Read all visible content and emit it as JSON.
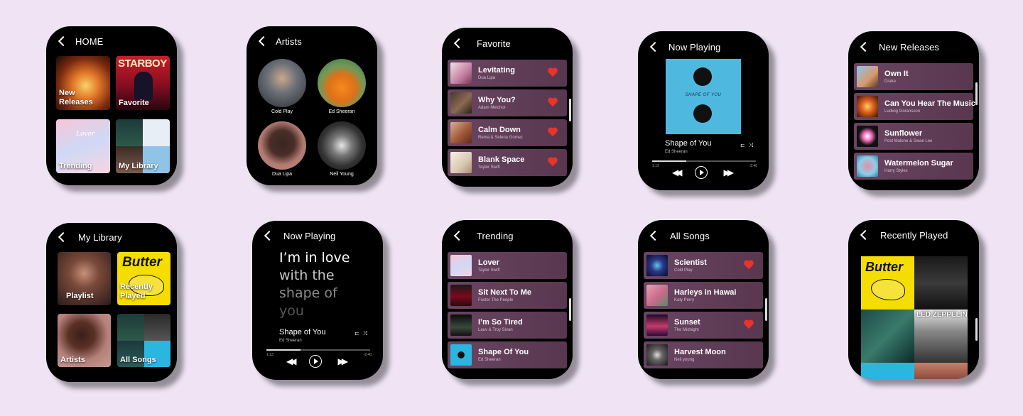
{
  "screens": {
    "home": {
      "title": "HOME",
      "tiles": [
        "New Releases",
        "Favorite",
        "Trending",
        "My Library"
      ],
      "tile1_line1": "New",
      "tile1_line2": "Releases"
    },
    "artists": {
      "title": "Artists",
      "items": [
        "Cold Play",
        "Ed Sheeran",
        "Dua Lipa",
        "Neil Young"
      ]
    },
    "favorite": {
      "title": "Favorite",
      "songs": [
        {
          "title": "Levitating",
          "artist": "Dua Lipa"
        },
        {
          "title": "Why You?",
          "artist": "Adam Melchor"
        },
        {
          "title": "Calm Down",
          "artist": "Rema & Selena Gomez"
        },
        {
          "title": "Blank Space",
          "artist": "Taylor Swift"
        }
      ]
    },
    "now_playing": {
      "title": "Now Playing",
      "song": "Shape of You",
      "artist": "Ed Sheeran",
      "elapsed": "1:13",
      "remaining": "-2:40",
      "progress": 0.33
    },
    "new_releases": {
      "title": "New Releases",
      "songs": [
        {
          "title": "Own It",
          "artist": "Drake"
        },
        {
          "title": "Can You Hear The Music",
          "artist": "Ludwig Goransson"
        },
        {
          "title": "Sunflower",
          "artist": "Post Malone & Swae Lee"
        },
        {
          "title": "Watermelon Sugar",
          "artist": "Harry Styles"
        }
      ]
    },
    "my_library": {
      "title": "My Library",
      "tiles": [
        "Playlist",
        "Recently Played",
        "Artists",
        "All Songs"
      ],
      "tile2_line1": "Recently",
      "tile2_line2": "Played"
    },
    "now_playing_lyrics": {
      "title": "Now Playing",
      "lyrics": [
        "I’m in love",
        "with the",
        "shape of",
        "you"
      ],
      "song": "Shape of You",
      "artist": "Ed Sheeran",
      "elapsed": "1:13",
      "remaining": "-2:40",
      "progress": 0.33
    },
    "trending": {
      "title": "Trending",
      "songs": [
        {
          "title": "Lover",
          "artist": "Taylor Swift"
        },
        {
          "title": "Sit Next To Me",
          "artist": "Foster The People"
        },
        {
          "title": "I’m So Tired",
          "artist": "Lauv & Troy Sivan"
        },
        {
          "title": "Shape Of You",
          "artist": "Ed Sheeran"
        }
      ]
    },
    "all_songs": {
      "title": "All Songs",
      "songs": [
        {
          "title": "Scientist",
          "artist": "Cold Play"
        },
        {
          "title": "Harleys in Hawai",
          "artist": "Katy Perry"
        },
        {
          "title": "Sunset",
          "artist": "The Midnight"
        },
        {
          "title": "Harvest Moon",
          "artist": "Neil young"
        }
      ]
    },
    "recently_played": {
      "title": "Recently Played"
    }
  },
  "album_text": {
    "starboy": "STARBOY",
    "butter": "Butter",
    "zeppelin": "LED ZEPPELIN",
    "lover": "Lover",
    "shape": "SHAPE OF YOU"
  },
  "colors": {
    "background": "#efe3f4",
    "row": "#6a4562",
    "heart": "#e8342b",
    "cover": "#4fb8de"
  },
  "icons": [
    "back-arrow-icon",
    "heart-icon",
    "play-icon",
    "rewind-icon",
    "fast-forward-icon",
    "shuffle-icon",
    "queue-icon"
  ]
}
